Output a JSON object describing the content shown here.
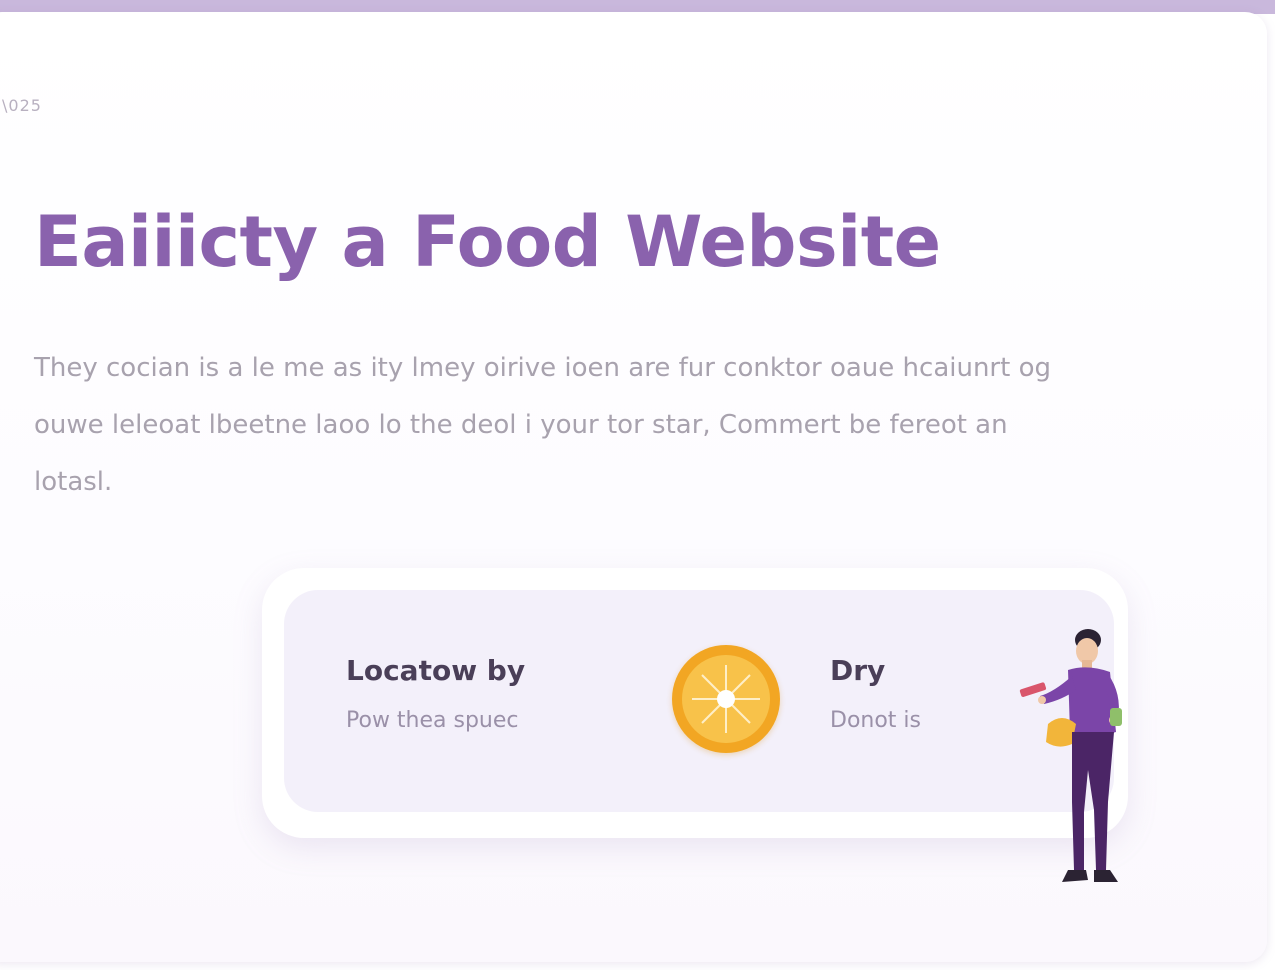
{
  "page": {
    "eyebrow": "\\025",
    "headline": "Eaiiicty a Food Website",
    "body": "They cocian is a le me as ity lmey oirive ioen are fur conktor oaue hcaiunrt og ouwe leleoat lbeetne laoo lo the deol i your tor star, Commert be fereot an lotasl."
  },
  "feature_panel": {
    "items": [
      {
        "title": "Locatow by",
        "subtitle": "Pow thea spuec"
      },
      {
        "title": "Dry",
        "subtitle": "Donot is"
      }
    ],
    "badge_icon": "orange-slice-icon",
    "illustration": "delivery-person-illustration"
  },
  "colors": {
    "accent": "#8a62ad",
    "top_strip": "#c9b8dc",
    "orange": "#f2a623",
    "panel": "#f3f0fa"
  }
}
